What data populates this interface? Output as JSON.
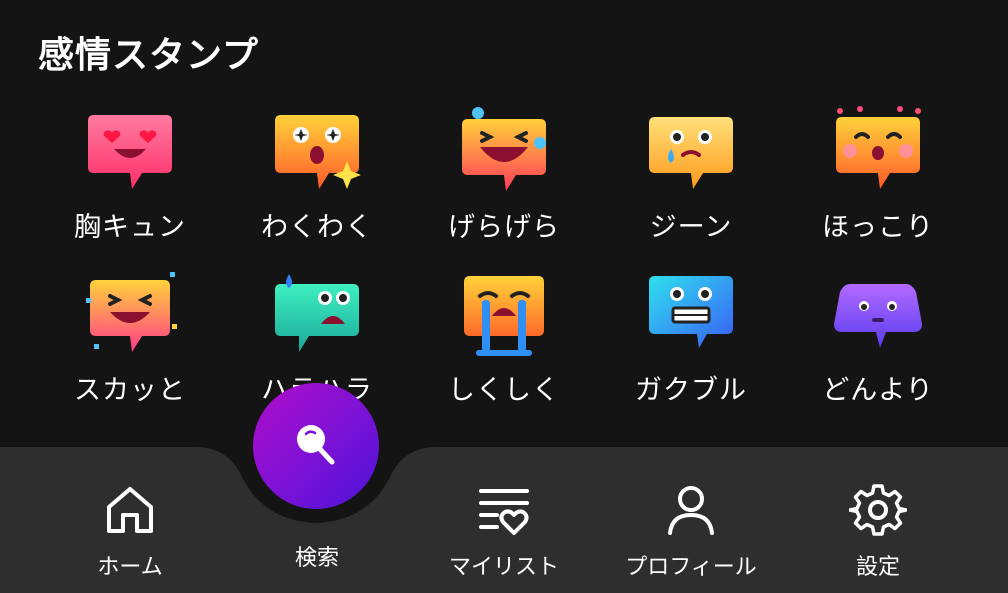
{
  "section": {
    "title": "感情スタンプ"
  },
  "stamps": [
    {
      "label": "胸キュン",
      "icon": "heart-eyes-bubble-icon",
      "color": "#ff4d7a"
    },
    {
      "label": "わくわく",
      "icon": "starry-eyes-bubble-icon",
      "color": "#ff8a2a"
    },
    {
      "label": "げらげら",
      "icon": "laughing-tears-bubble-icon",
      "color": "#ff5a3c"
    },
    {
      "label": "ジーン",
      "icon": "moved-tear-bubble-icon",
      "color": "#ffb020"
    },
    {
      "label": "ほっこり",
      "icon": "warm-blush-bubble-icon",
      "color": "#ff6a3a"
    },
    {
      "label": "スカッと",
      "icon": "refreshed-confetti-bubble-icon",
      "color": "#ff4fa0"
    },
    {
      "label": "ハラハラ",
      "icon": "nervous-sweat-bubble-icon",
      "color": "#2fd3a6"
    },
    {
      "label": "しくしく",
      "icon": "crying-bubble-icon",
      "color": "#ff7a2a"
    },
    {
      "label": "ガクブル",
      "icon": "shivering-bubble-icon",
      "color": "#28b6f6"
    },
    {
      "label": "どんより",
      "icon": "gloomy-bubble-icon",
      "color": "#7b5cff"
    }
  ],
  "nav": {
    "home": "ホーム",
    "search": "検索",
    "mylist": "マイリスト",
    "profile": "プロフィール",
    "settings": "設定"
  }
}
